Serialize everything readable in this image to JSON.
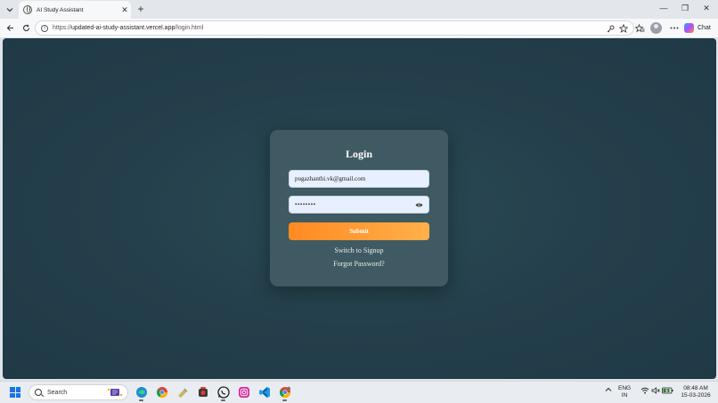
{
  "browser": {
    "tab_title": "AI Study Assistant",
    "url_scheme": "https://",
    "url_host": "updated-ai-study-assistant.vercel.app",
    "url_path": "/login.html",
    "chat_label": "Chat",
    "tab_close": "✕",
    "new_tab": "+",
    "minimize": "—",
    "restore": "❐",
    "close": "✕"
  },
  "login": {
    "title": "Login",
    "email_value": "pugazhanthi.vk@gmail.com",
    "password_value": "••••••••",
    "submit_label": "Submit",
    "switch_label": "Switch to Signup",
    "forgot_label": "Forgot Password?"
  },
  "taskbar": {
    "search_label": "Search",
    "lang_line1": "ENG",
    "lang_line2": "IN",
    "time": "08:48 AM",
    "date": "15-03-2026"
  },
  "colors": {
    "background": "#243f4b",
    "card": "#3f5a62",
    "input": "#e8f0fe",
    "submit_start": "#ff8a22",
    "submit_end": "#ffb04a"
  }
}
